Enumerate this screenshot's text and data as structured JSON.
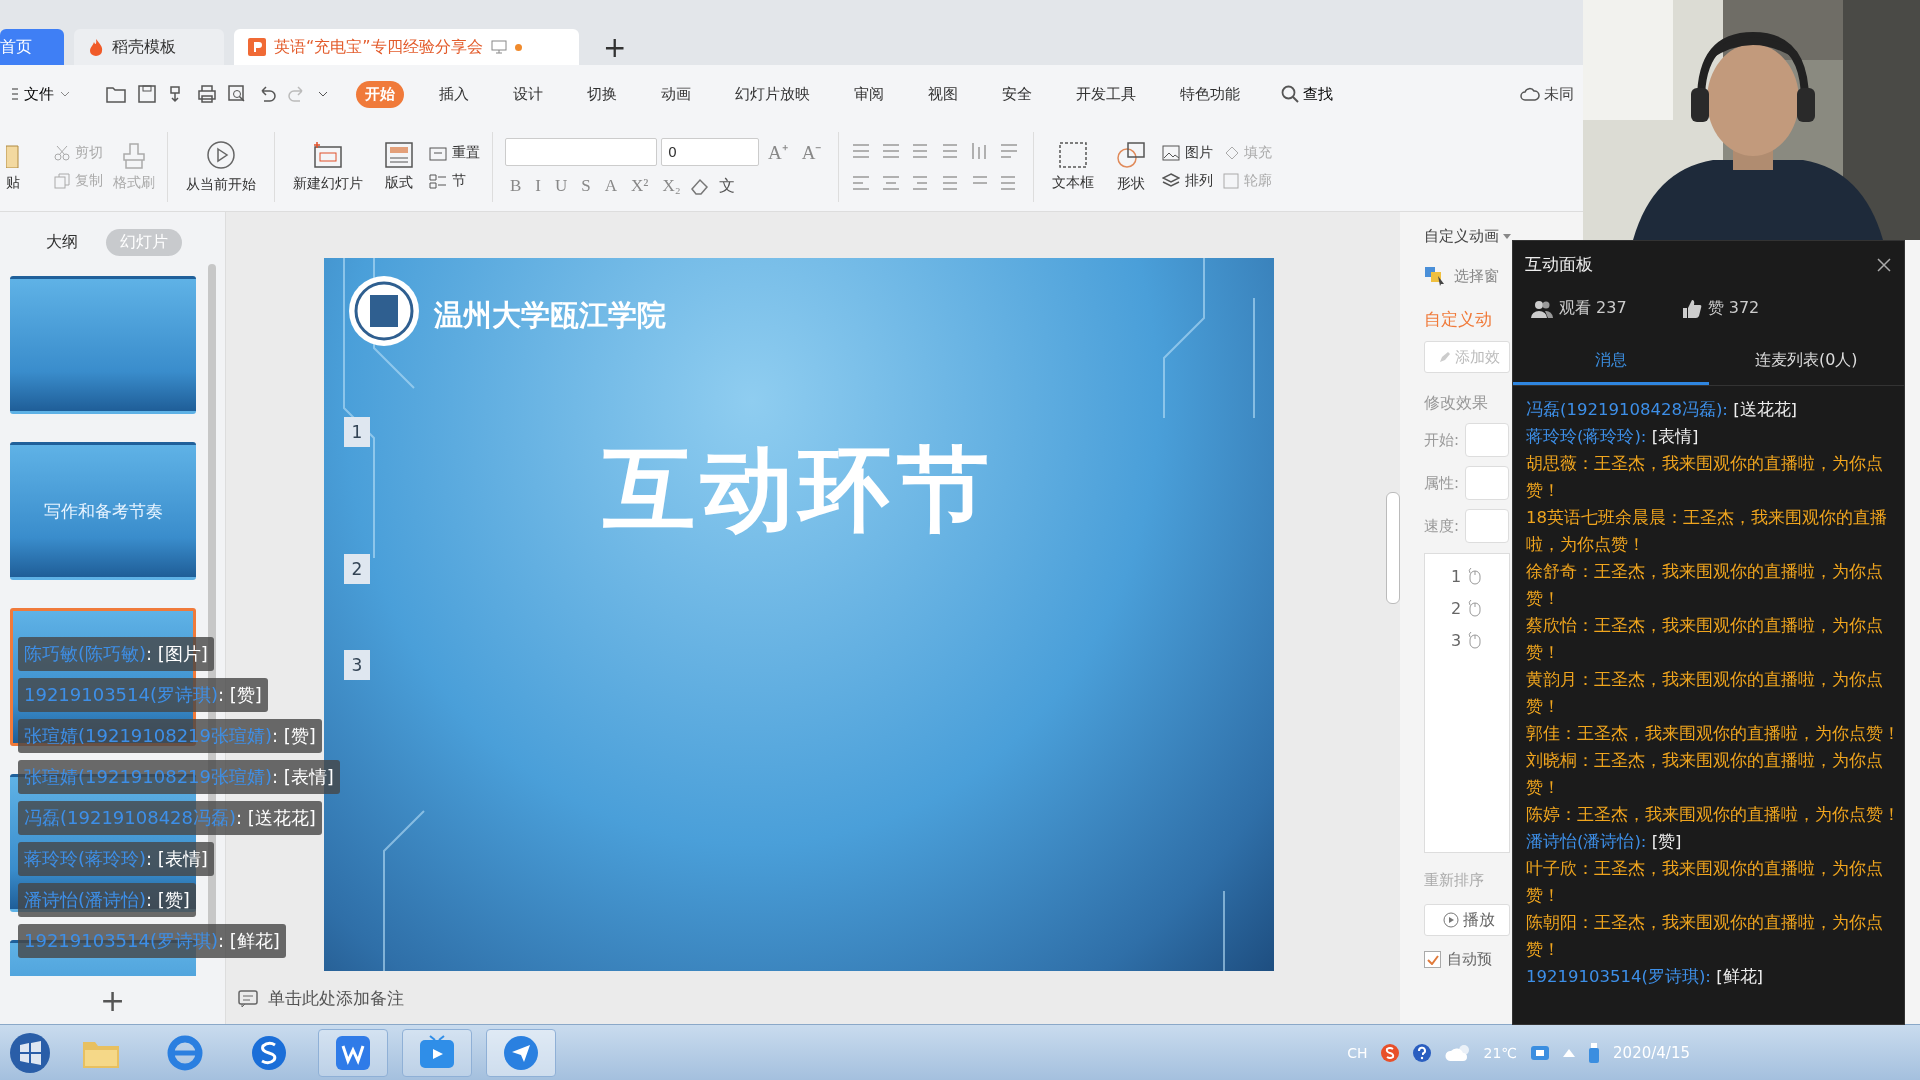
{
  "tabs": [
    {
      "label": "首页",
      "kind": "home",
      "selected": false
    },
    {
      "label": "稻壳模板",
      "kind": "docer",
      "selected": false
    },
    {
      "label": "英语“充电宝”专四经验分享会",
      "kind": "doc",
      "selected": true
    }
  ],
  "new_tab": "+",
  "menu": {
    "file": "文件",
    "items": [
      {
        "label": "开始",
        "selected": true
      },
      {
        "label": "插入",
        "selected": false
      },
      {
        "label": "设计",
        "selected": false
      },
      {
        "label": "切换",
        "selected": false
      },
      {
        "label": "动画",
        "selected": false
      },
      {
        "label": "幻灯片放映",
        "selected": false
      },
      {
        "label": "审阅",
        "selected": false
      },
      {
        "label": "视图",
        "selected": false
      },
      {
        "label": "安全",
        "selected": false
      },
      {
        "label": "开发工具",
        "selected": false
      },
      {
        "label": "特色功能",
        "selected": false
      }
    ],
    "search": "查找",
    "sync": "未同"
  },
  "ribbon": {
    "paste": "贴",
    "clipboard": [
      {
        "label": "剪切",
        "disabled": true
      },
      {
        "label": "复制",
        "disabled": true
      },
      {
        "label": "格式刷",
        "disabled": true
      }
    ],
    "from_current": "从当前开始",
    "new_slide": "新建幻灯片",
    "layout": "版式",
    "reset": "重置",
    "section": "节",
    "font_size": "0",
    "size_buttons": [
      "A⁺",
      "A⁻"
    ],
    "format_buttons": [
      "B",
      "I",
      "U",
      "S",
      "A",
      "X²",
      "X₂"
    ],
    "phonetic": "文",
    "text_box": "文本框",
    "shape": "形状",
    "picture": "图片",
    "arrange": "排列",
    "fill": "填充",
    "outline": "轮廓"
  },
  "view_tabs": [
    {
      "label": "大纲",
      "selected": false
    },
    {
      "label": "幻灯片",
      "selected": true
    }
  ],
  "thumbnails": [
    {
      "selected": false
    },
    {
      "selected": false,
      "title": "写作和备考节奏"
    },
    {
      "selected": true
    },
    {
      "selected": false
    },
    {
      "selected": false
    }
  ],
  "add_slide": "+",
  "slide": {
    "school": "温州大学瓯江学院",
    "title": "互动环节",
    "markers": [
      "1",
      "2",
      "3"
    ]
  },
  "notes": "单击此处添加备注",
  "animation_pane": {
    "header": "自定义动画",
    "select_pane": "选择窗",
    "title": "自定义动",
    "add_effect": "添加效",
    "modify": "修改效果",
    "fields": [
      "开始:",
      "属性:",
      "速度:"
    ],
    "effects": [
      "1",
      "2",
      "3"
    ],
    "reorder": "重新排序",
    "play": "播放",
    "auto_preview": {
      "label": "自动预",
      "checked": true
    }
  },
  "danmaku": [
    {
      "name": "陈巧敏(陈巧敏)",
      "message": " : [图片]"
    },
    {
      "name": "19219103514(罗诗琪)",
      "message": " : [赞]"
    },
    {
      "name": "张瑄婧(19219108219张瑄婧)",
      "message": " : [赞]"
    },
    {
      "name": "张瑄婧(19219108219张瑄婧)",
      "message": " : [表情]"
    },
    {
      "name": "冯磊(19219108428冯磊)",
      "message": " : [送花花]"
    },
    {
      "name": "蒋玲玲(蒋玲玲)",
      "message": " : [表情]"
    },
    {
      "name": "潘诗怡(潘诗怡)",
      "message": " : [赞]"
    },
    {
      "name": "19219103514(罗诗琪)",
      "message": " : [鲜花]"
    }
  ],
  "chat": {
    "title": "互动面板",
    "viewers": "观看 237",
    "likes": "赞 372",
    "tabs": [
      {
        "label": "消息",
        "selected": true
      },
      {
        "label": "连麦列表(0人)",
        "selected": false
      }
    ],
    "messages": [
      {
        "kind": "user",
        "name": "冯磊(19219108428冯磊):",
        "content": "[送花花]"
      },
      {
        "kind": "user",
        "name": "蒋玲玲(蒋玲玲):",
        "content": "[表情]"
      },
      {
        "kind": "system",
        "text": "胡思薇：王圣杰，我来围观你的直播啦，为你点赞！"
      },
      {
        "kind": "system",
        "text": "18英语七班余晨晨：王圣杰，我来围观你的直播啦，为你点赞！"
      },
      {
        "kind": "system",
        "text": "徐舒奇：王圣杰，我来围观你的直播啦，为你点赞！"
      },
      {
        "kind": "system",
        "text": "蔡欣怡：王圣杰，我来围观你的直播啦，为你点赞！"
      },
      {
        "kind": "system",
        "text": "黄韵月：王圣杰，我来围观你的直播啦，为你点赞！"
      },
      {
        "kind": "system",
        "text": "郭佳：王圣杰，我来围观你的直播啦，为你点赞！"
      },
      {
        "kind": "system",
        "text": "刘晓桐：王圣杰，我来围观你的直播啦，为你点赞！"
      },
      {
        "kind": "system",
        "text": "陈婷：王圣杰，我来围观你的直播啦，为你点赞！"
      },
      {
        "kind": "user",
        "name": "潘诗怡(潘诗怡):",
        "content": "[赞]"
      },
      {
        "kind": "system",
        "text": "叶子欣：王圣杰，我来围观你的直播啦，为你点赞！"
      },
      {
        "kind": "system",
        "text": "陈朝阳：王圣杰，我来围观你的直播啦，为你点赞！"
      },
      {
        "kind": "user",
        "name": "19219103514(罗诗琪):",
        "content": "[鲜花]"
      }
    ]
  },
  "taskbar": {
    "lang": "CH",
    "temperature": "21℃",
    "date": "2020/4/15"
  }
}
